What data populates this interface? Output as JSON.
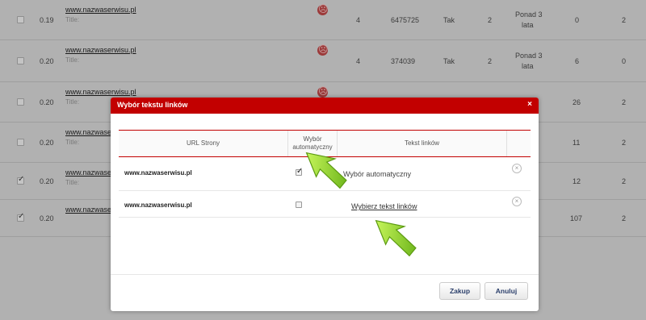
{
  "background_table": {
    "rows": [
      {
        "checked": false,
        "price": "0.19",
        "url": "www.nazwaserwisu.pl",
        "title": "Title:",
        "sad": true,
        "pr": "4",
        "alexa": "6475725",
        "tak": "Tak",
        "n": "2",
        "age": "Ponad 3",
        "age2": "lata",
        "a": "0",
        "b": "2"
      },
      {
        "checked": false,
        "price": "0.20",
        "url": "www.nazwaserwisu.pl",
        "title": "Title:",
        "sad": true,
        "pr": "4",
        "alexa": "374039",
        "tak": "Tak",
        "n": "2",
        "age": "Ponad 3",
        "age2": "lata",
        "a": "6",
        "b": "0"
      },
      {
        "checked": false,
        "price": "0.20",
        "url": "www.nazwaserwisu.pl",
        "title": "Title:",
        "sad": true,
        "a": "26",
        "b": "2"
      },
      {
        "checked": false,
        "price": "0.20",
        "url": "www.nazwaser",
        "title": "Title:",
        "a": "11",
        "b": "2"
      },
      {
        "checked": true,
        "price": "0.20",
        "url": "www.nazwaser",
        "title": "Title:",
        "a": "12",
        "b": "2"
      },
      {
        "checked": true,
        "price": "0.20",
        "url": "www.nazwaser",
        "title": "",
        "a": "107",
        "b": "2"
      }
    ]
  },
  "modal": {
    "title": "Wybór tekstu linków",
    "close": "×",
    "headers": {
      "url": "URL Strony",
      "auto_line1": "Wybór",
      "auto_line2": "automatyczny",
      "text": "Tekst linków"
    },
    "rows": [
      {
        "url": "www.nazwaserwisu.pl",
        "auto": true,
        "text": "Wybór automatyczny",
        "is_link": false
      },
      {
        "url": "www.nazwaserwisu.pl",
        "auto": false,
        "text": "Wybierz tekst linków",
        "is_link": true
      }
    ],
    "remove_icon": "×",
    "buttons": {
      "buy": "Zakup",
      "cancel": "Anuluj"
    }
  },
  "colors": {
    "brand_red": "#c20000",
    "arrow_green": "#8ed12a"
  }
}
